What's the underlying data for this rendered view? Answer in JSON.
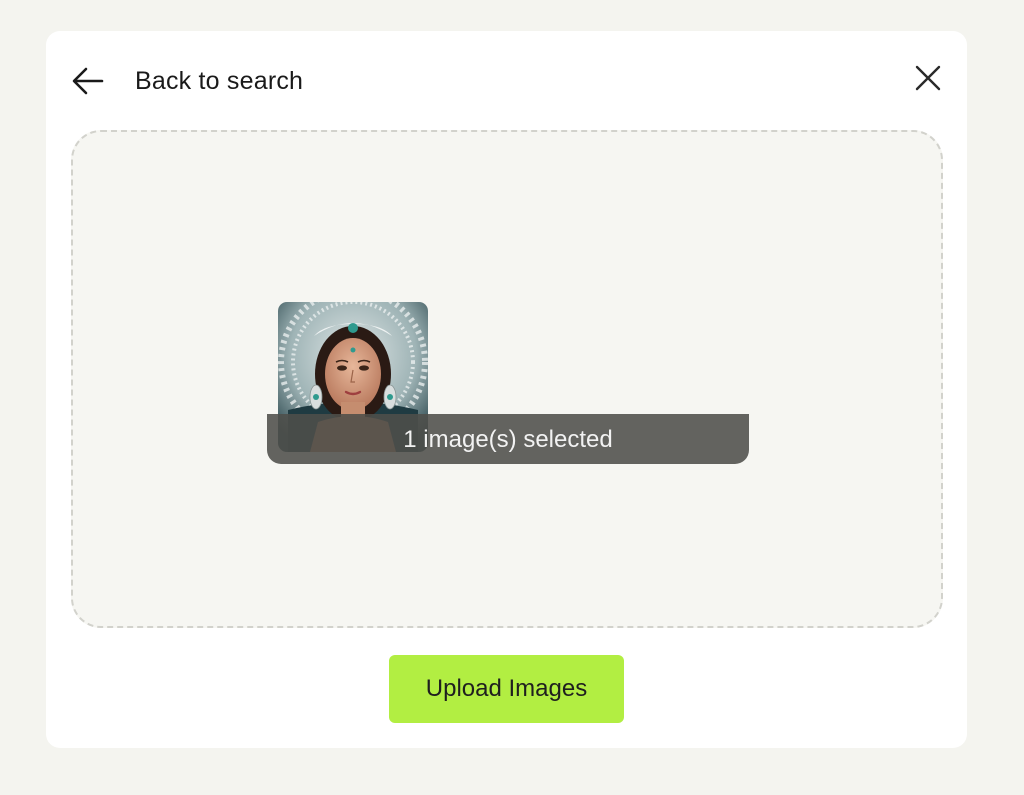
{
  "header": {
    "back_label": "Back to search",
    "back_icon": "arrow-left-icon",
    "close_icon": "close-icon"
  },
  "dropzone": {
    "selected_count_text": "1 image(s) selected",
    "thumbnail_icon": "selected-image-thumbnail"
  },
  "actions": {
    "upload_label": "Upload Images"
  },
  "colors": {
    "page_background": "#f4f4ef",
    "card_background": "#ffffff",
    "dropzone_background": "#f6f6f2",
    "dropzone_border": "#d2d2cc",
    "selected_bar": "#4e4e4a",
    "upload_button": "#b2ee42"
  }
}
